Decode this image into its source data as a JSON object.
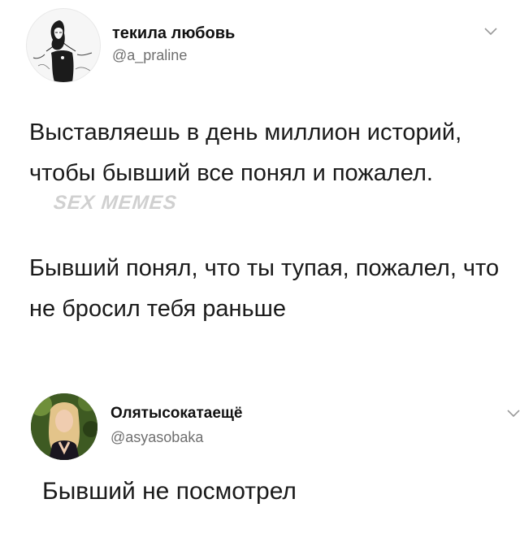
{
  "tweets": [
    {
      "display_name": "текила любовь",
      "handle": "@a_praline",
      "paragraphs": [
        "Выставляешь в день миллион историй, чтобы бывший все понял и пожалел.",
        "Бывший понял, что ты тупая, пожалел, что не бросил тебя раньше"
      ]
    },
    {
      "display_name": "Олятысокатаещё",
      "handle": "@asyasobaka",
      "paragraphs": [
        "Бывший не посмотрел"
      ]
    }
  ],
  "watermark": "SEX MEMES",
  "icons": {
    "menu": "chevron-down-icon",
    "avatar_1": "avatar-sketch-girl",
    "avatar_2": "avatar-photo-blonde"
  },
  "colors": {
    "background": "#ffffff",
    "text": "#1a1a1a",
    "handle": "#6f6f6f"
  }
}
